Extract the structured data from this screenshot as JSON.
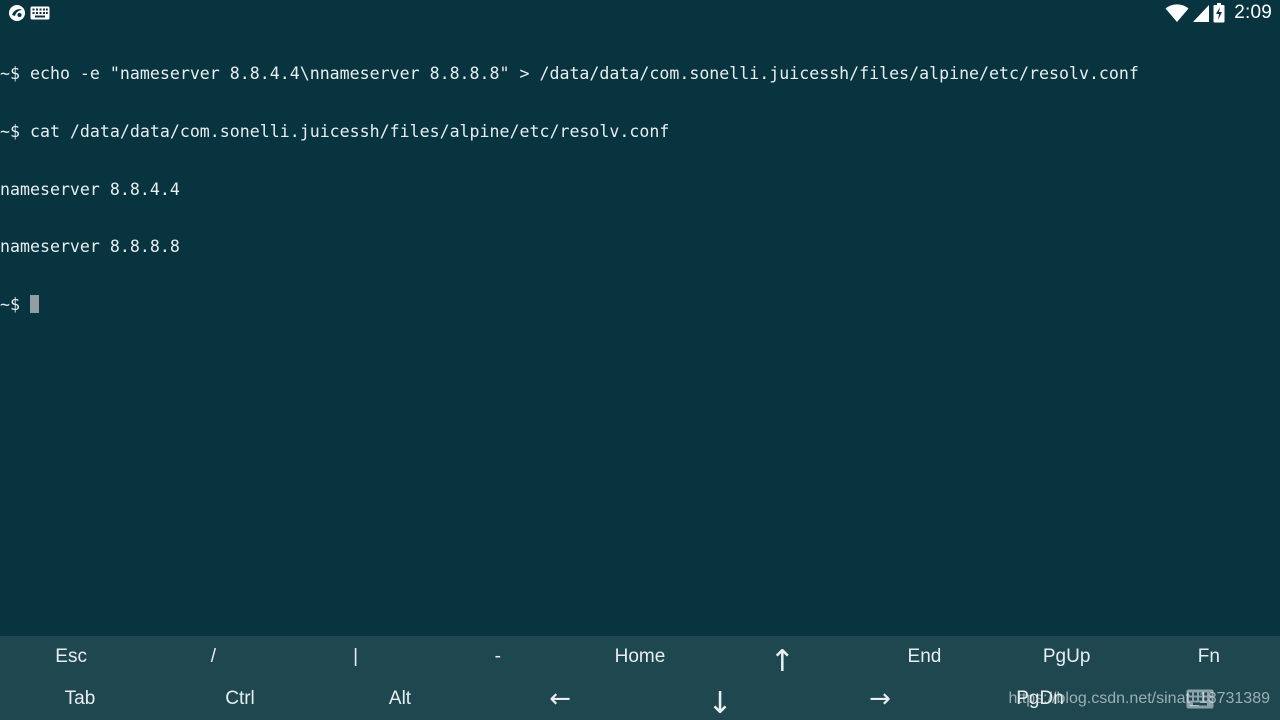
{
  "status_bar": {
    "time": "2:09",
    "icons_left": [
      "juicessh-notification-icon",
      "keyboard-notification-icon"
    ],
    "icons_right": [
      "wifi-icon",
      "cell-signal-icon",
      "battery-charging-icon"
    ]
  },
  "terminal": {
    "lines": [
      "~$ echo -e \"nameserver 8.8.4.4\\nnameserver 8.8.8.8\" > /data/data/com.sonelli.juicessh/files/alpine/etc/resolv.conf",
      "~$ cat /data/data/com.sonelli.juicessh/files/alpine/etc/resolv.conf",
      "nameserver 8.8.4.4",
      "nameserver 8.8.8.8"
    ],
    "prompt": "~$ "
  },
  "extra_keys": {
    "row1": [
      "Esc",
      "/",
      "|",
      "-",
      "Home",
      "↑",
      "End",
      "PgUp",
      "Fn"
    ],
    "row2": [
      "Tab",
      "Ctrl",
      "Alt",
      "←",
      "↓",
      "→",
      "PgDn"
    ]
  },
  "watermark": {
    "text": "https://blog.csdn.net/sinat_18731389"
  },
  "colors": {
    "terminal_bg": "#083440",
    "keybar_bg": "#1f4750",
    "text": "#e8eef0"
  }
}
